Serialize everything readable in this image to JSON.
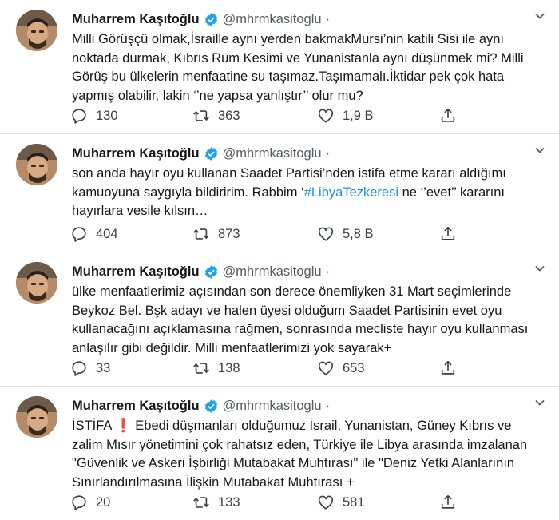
{
  "author": {
    "name": "Muharrem Kaşıtoğlu",
    "handle": "@mhrmkasitoglu",
    "separator": "·"
  },
  "icons": {
    "reply": "reply-icon",
    "retweet": "retweet-icon",
    "like": "like-icon",
    "share": "share-icon",
    "verified": "verified-badge-icon",
    "caret": "chevron-down-icon"
  },
  "colors": {
    "verified": "#1da1f2",
    "hashtag": "#1b95e0",
    "exclamation": "#e0245e"
  },
  "tweets": [
    {
      "lines": [
        "Milli Görüşçü olmak,İsraille aynı yerden bakmakMursi’nin katili Sisi ile aynı",
        "noktada durmak, Kıbrıs Rum Kesimi ve Yunanistanla aynı düşünmek mi? Milli",
        "Görüş bu ülkelerin menfaatine su taşımaz.Taşımamalı.İktidar pek çok hata",
        "yapmış olabilir, lakin ‘’ne yapsa yanlıştır’’ olur mu?"
      ],
      "replies": "130",
      "retweets": "363",
      "likes": "1,9 B"
    },
    {
      "lines": [
        "son anda hayır oyu kullanan Saadet Partisi’nden istifa etme kararı aldığımı",
        "kamuoyuna saygıyla bildiririm. Rabbim ‘",
        "hayırlara vesile kılsın…"
      ],
      "line2_hashtag": "#LibyaTezkeresi",
      "line2_after": " ne ‘’evet’’ kararını",
      "replies": "404",
      "retweets": "873",
      "likes": "5,8 B"
    },
    {
      "lines": [
        "ülke menfaatlerimiz açısından son derece önemliyken 31 Mart seçimlerinde",
        "Beykoz Bel. Bşk adayı ve halen üyesi olduğum Saadet Partisinin evet oyu",
        "kullanacağını açıklamasına rağmen, sonrasında mecliste hayır oyu kullanması",
        "anlaşılır gibi değildir. Milli menfaatlerimizi yok sayarak+"
      ],
      "replies": "33",
      "retweets": "138",
      "likes": "653"
    },
    {
      "lines": [
        "İSTİFA",
        "zalim Mısır yönetimini çok rahatsız eden, Türkiye ile Libya arasında imzalanan",
        "\"Güvenlik ve Askeri İşbirliği Mutabakat Muhtırası\" ile \"Deniz Yetki Alanlarının",
        "Sınırlandırılmasına İlişkin Mutabakat Muhtırası +"
      ],
      "line1_mark": "❗",
      "line1_after": " Ebedi düşmanları olduğumuz İsrail, Yunanistan, Güney Kıbrıs ve",
      "replies": "20",
      "retweets": "133",
      "likes": "581"
    }
  ]
}
